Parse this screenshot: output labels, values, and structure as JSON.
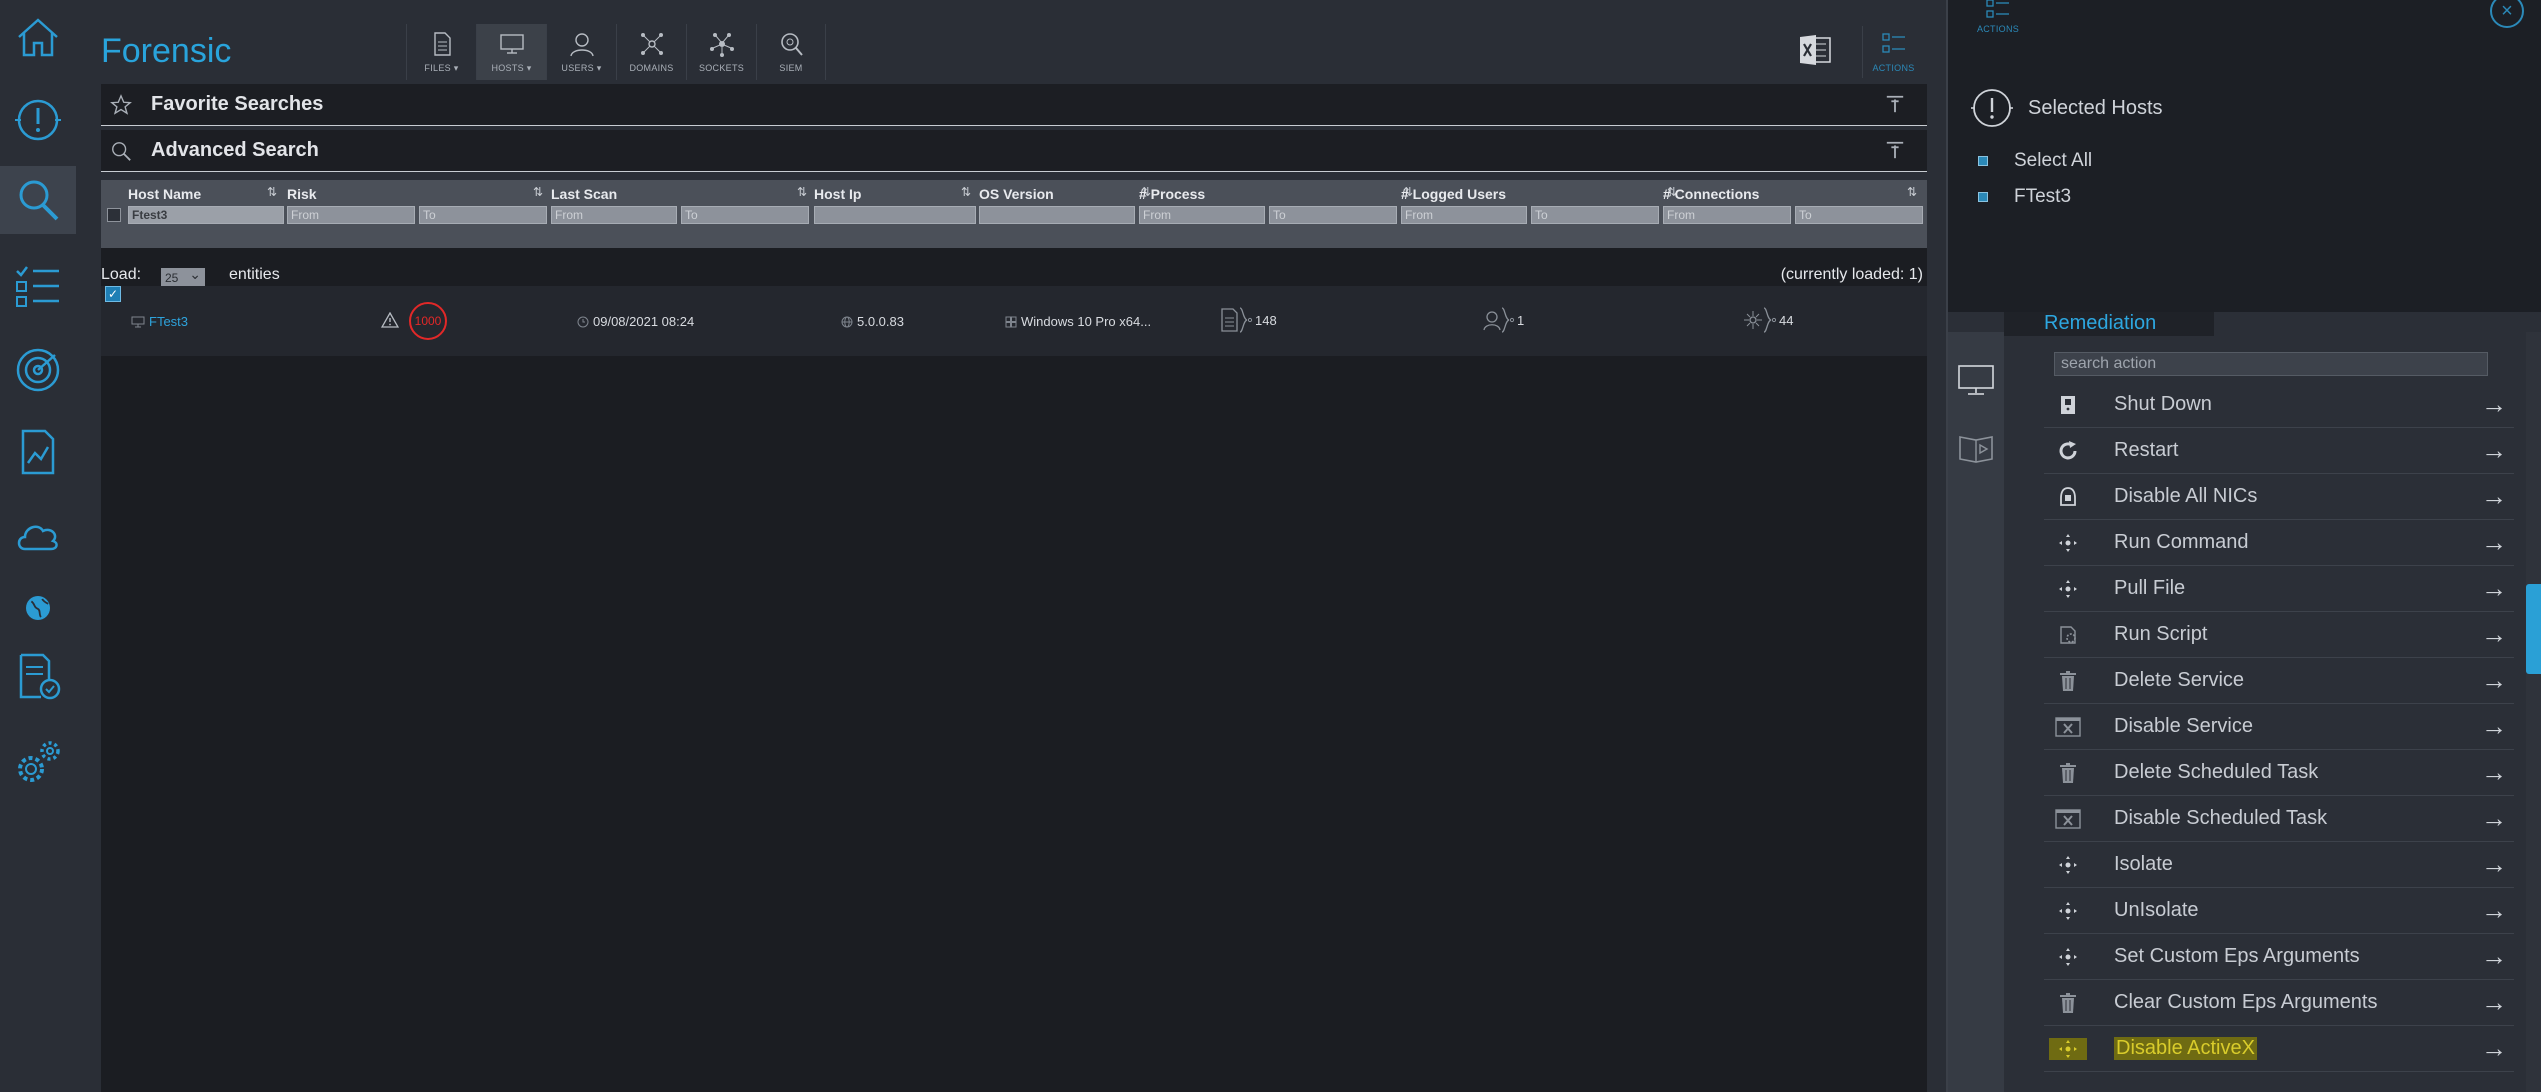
{
  "app": {
    "title": "Forensic"
  },
  "toolbar": {
    "buttons": [
      {
        "label": "FILES ▾",
        "icon": "file-icon"
      },
      {
        "label": "HOSTS ▾",
        "icon": "monitor-icon",
        "active": true
      },
      {
        "label": "USERS ▾",
        "icon": "user-icon"
      },
      {
        "label": "DOMAINS",
        "icon": "network-icon"
      },
      {
        "label": "SOCKETS",
        "icon": "socket-icon"
      },
      {
        "label": "SIEM",
        "icon": "siem-icon"
      }
    ],
    "actions_label": "ACTIONS",
    "excel_icon": "excel-icon"
  },
  "sections": {
    "favorites": "Favorite Searches",
    "advanced": "Advanced Search"
  },
  "filters": {
    "columns": [
      "Host Name",
      "Risk",
      "Last Scan",
      "Host Ip",
      "OS Version",
      "# Process",
      "# Logged Users",
      "# Connections"
    ],
    "host_name_value": "Ftest3",
    "from_placeholder": "From",
    "to_placeholder": "To"
  },
  "table": {
    "load_label": "Load:",
    "load_value": "25",
    "entities_label": "entities",
    "loaded_text": "(currently loaded: 1)",
    "rows": [
      {
        "host_name": "FTest3",
        "risk": "1000",
        "last_scan": "09/08/2021 08:24",
        "host_ip": "5.0.0.83",
        "os_version": "Windows 10 Pro x64...",
        "process": "148",
        "logged_users": "1",
        "connections": "44"
      }
    ]
  },
  "right_panel": {
    "actions_label": "ACTIONS",
    "selected_hosts_title": "Selected Hosts",
    "select_all": "Select All",
    "host": "FTest3",
    "remediation_tab": "Remediation",
    "search_placeholder": "search action",
    "actions": [
      {
        "label": "Shut Down",
        "icon": "power-icon"
      },
      {
        "label": "Restart",
        "icon": "restart-icon"
      },
      {
        "label": "Disable All NICs",
        "icon": "nic-icon"
      },
      {
        "label": "Run Command",
        "icon": "move-icon"
      },
      {
        "label": "Pull File",
        "icon": "move-icon"
      },
      {
        "label": "Run Script",
        "icon": "script-icon"
      },
      {
        "label": "Delete Service",
        "icon": "trash-icon"
      },
      {
        "label": "Disable Service",
        "icon": "disable-icon"
      },
      {
        "label": "Delete Scheduled Task",
        "icon": "trash-icon"
      },
      {
        "label": "Disable Scheduled Task",
        "icon": "disable-icon"
      },
      {
        "label": "Isolate",
        "icon": "move-icon"
      },
      {
        "label": "UnIsolate",
        "icon": "move-icon"
      },
      {
        "label": "Set Custom Eps Arguments",
        "icon": "move-icon"
      },
      {
        "label": "Clear Custom Eps Arguments",
        "icon": "trash-icon"
      },
      {
        "label": "Disable ActiveX",
        "icon": "move-icon",
        "highlighted": true
      }
    ]
  },
  "colors": {
    "accent": "#29a4dc",
    "risk": "#e22828",
    "highlight": "#d9cc2b"
  }
}
